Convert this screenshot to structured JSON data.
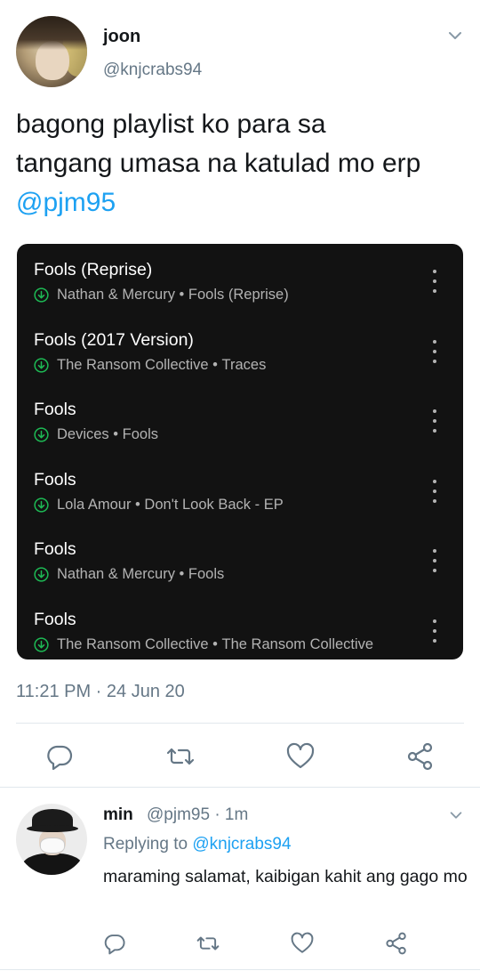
{
  "tweet": {
    "display_name": "joon",
    "handle": "@knjcrabs94",
    "text_line1": "bagong playlist ko para sa",
    "text_line2": "tangang umasa na katulad mo erp",
    "mention": "@pjm95",
    "timestamp": "11:21 PM · 24 Jun 20"
  },
  "playlist": {
    "background": "#121212",
    "download_color": "#1db954",
    "tracks": [
      {
        "title": "Fools (Reprise)",
        "artist": "Nathan & Mercury",
        "album": "Fools (Reprise)"
      },
      {
        "title": "Fools (2017 Version)",
        "artist": "The Ransom Collective",
        "album": "Traces"
      },
      {
        "title": "Fools",
        "artist": "Devices",
        "album": "Fools"
      },
      {
        "title": "Fools",
        "artist": "Lola Amour",
        "album": "Don't Look Back - EP"
      },
      {
        "title": "Fools",
        "artist": "Nathan & Mercury",
        "album": "Fools"
      },
      {
        "title": "Fools",
        "artist": "The Ransom Collective",
        "album": "The Ransom Collective"
      }
    ]
  },
  "reply": {
    "display_name": "min",
    "meta": "@pjm95 · 1m",
    "replying_prefix": "Replying to",
    "replying_to": "@knjcrabs94",
    "text": "maraming salamat, kaibigan kahit ang gago mo"
  },
  "icons": [
    "reply-icon",
    "retweet-icon",
    "like-icon",
    "share-icon",
    "chevron-down-icon",
    "download-icon",
    "more-vertical-icon"
  ],
  "colors": {
    "accent": "#1da1f2",
    "secondary_text": "#657786",
    "divider": "#e1e8ed"
  }
}
